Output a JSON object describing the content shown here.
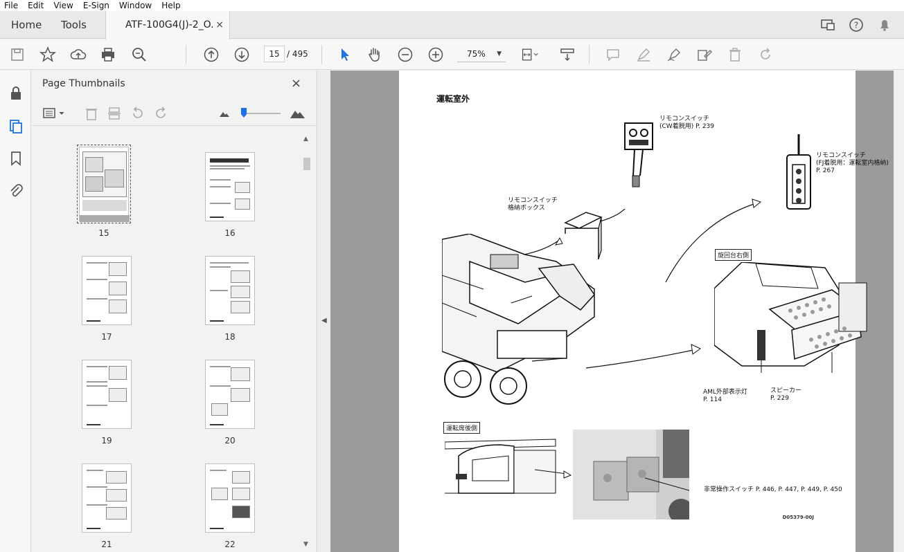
{
  "menu": [
    "File",
    "Edit",
    "View",
    "E-Sign",
    "Window",
    "Help"
  ],
  "tabs": {
    "home": "Home",
    "tools": "Tools",
    "document": "ATF-100G4(J)-2_O...",
    "close": "×"
  },
  "toolbar": {
    "current_page": "15",
    "total_pages": "/ 495",
    "zoom": "75%",
    "zoom_caret": "▼"
  },
  "panel": {
    "title": "Page Thumbnails",
    "close": "×",
    "thumbnails": [
      {
        "label": "15"
      },
      {
        "label": "16"
      },
      {
        "label": "17"
      },
      {
        "label": "18"
      },
      {
        "label": "19"
      },
      {
        "label": "20"
      },
      {
        "label": "21"
      },
      {
        "label": "22"
      }
    ]
  },
  "document": {
    "title": "運転室外",
    "callouts": {
      "remote_cw": "リモコンスイッチ\n(CW着脱用) P. 239",
      "remote_fj": "リモコンスイッチ\n(FJ着脱用：運転室内格納)\nP. 267",
      "remote_box": "リモコンスイッチ\n格納ボックス",
      "aml_lamp": "AML外部表示灯\nP. 114",
      "speaker": "スピーカー\nP. 229",
      "emergency": "非常操作スイッチ P. 446, P. 447, P. 449, P. 450"
    },
    "box_labels": {
      "right_side": "旋回台右側",
      "rear": "運転席後側"
    },
    "code": "D05379-00J"
  }
}
